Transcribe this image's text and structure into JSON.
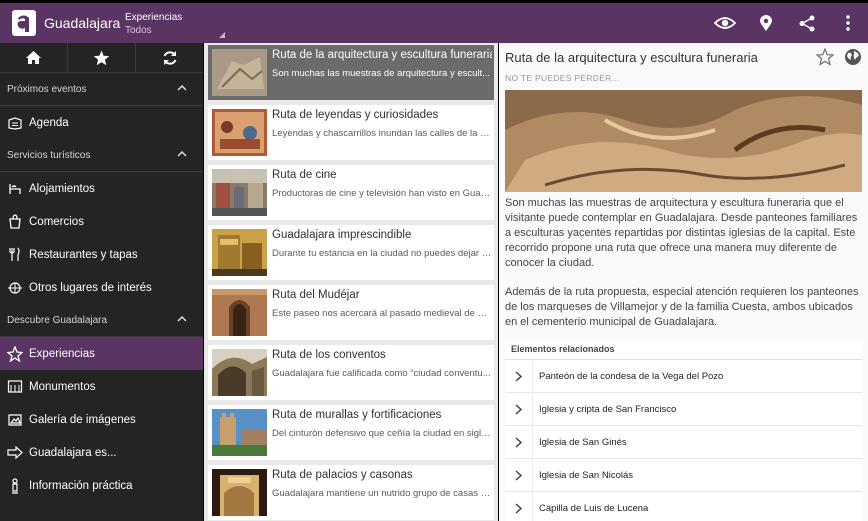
{
  "app": {
    "title": "Guadalajara",
    "section_label": "Experiencias",
    "section_value": "Todos"
  },
  "actions": [
    {
      "name": "eye-icon"
    },
    {
      "name": "location-pin-icon"
    },
    {
      "name": "share-icon"
    },
    {
      "name": "more-vert-icon"
    }
  ],
  "drawer": {
    "tabs": [
      "home-icon",
      "star-icon",
      "refresh-icon"
    ],
    "sections": [
      {
        "label": "Próximos eventos",
        "items": [
          {
            "label": "Agenda",
            "icon": "agenda-icon"
          }
        ]
      },
      {
        "label": "Servicios turísticos",
        "items": [
          {
            "label": "Alojamientos",
            "icon": "lodging-icon"
          },
          {
            "label": "Comercios",
            "icon": "shop-icon"
          },
          {
            "label": "Restaurantes y tapas",
            "icon": "restaurant-icon"
          },
          {
            "label": "Otros lugares de interés",
            "icon": "places-icon"
          }
        ]
      },
      {
        "label": "Descubre Guadalajara",
        "items": [
          {
            "label": "Experiencias",
            "icon": "experiences-icon",
            "active": true
          },
          {
            "label": "Monumentos",
            "icon": "monument-icon"
          },
          {
            "label": "Galería de imágenes",
            "icon": "gallery-icon"
          },
          {
            "label": "Guadalajara es...",
            "icon": "arrow-icon"
          },
          {
            "label": "Información práctica",
            "icon": "info-icon"
          }
        ]
      }
    ]
  },
  "routes": [
    {
      "title": "Ruta de la arquitectura y escultura funeraria",
      "subtitle": "Son muchas las muestras de arquitectura y escult...",
      "active": true
    },
    {
      "title": "Ruta de leyendas y curiosidades",
      "subtitle": "Leyendas y chascarrillos inundan las calles de la ci..."
    },
    {
      "title": "Ruta de cine",
      "subtitle": "Productoras de cine y televisión han visto en Guad..."
    },
    {
      "title": "Guadalajara imprescindible",
      "subtitle": "Durante tu estancia en la ciudad no puedes dejar d..."
    },
    {
      "title": "Ruta del Mudéjar",
      "subtitle": "Este paseo nos acercará al pasado medieval de Gu..."
    },
    {
      "title": "Ruta de los conventos",
      "subtitle": "Guadalajara fue calificada como “ciudad conventu..."
    },
    {
      "title": "Ruta de murallas y fortificaciones",
      "subtitle": "Del cinturón defensivo que ceñía la ciudad en siglo..."
    },
    {
      "title": "Ruta de palacios y casonas",
      "subtitle": "Guadalajara mantiene un nutrido grupo de casas s..."
    }
  ],
  "detail": {
    "title": "Ruta de la arquitectura y escultura funeraria",
    "tagline": "NO TE PUEDES PERDER...",
    "paragraph1": "Son muchas las muestras de arquitectura y escultura funeraria que el visitante puede contemplar en Guadalajara. Desde panteones familiares a esculturas yacentes repartidas por distintas iglesias de la capital. Este recorrido propone una ruta que ofrece una manera muy diferente de conocer la ciudad.",
    "paragraph2": "Además de la ruta propuesta, especial atención requieren los panteones de los marqueses de Villamejor y de la familia Cuesta, ambos ubicados en el cementerio municipal de Guadalajara.",
    "related_header": "Elementos relacionados",
    "related": [
      "Panteón de la condesa de la Vega del Pozo",
      "Iglesia y cripta de San Francisco",
      "Iglesia de San Ginés",
      "Iglesia de San Nicolás",
      "Capilla de Luis de Lucena"
    ]
  },
  "colors": {
    "accent": "#5a3463",
    "drawer": "#242424"
  }
}
